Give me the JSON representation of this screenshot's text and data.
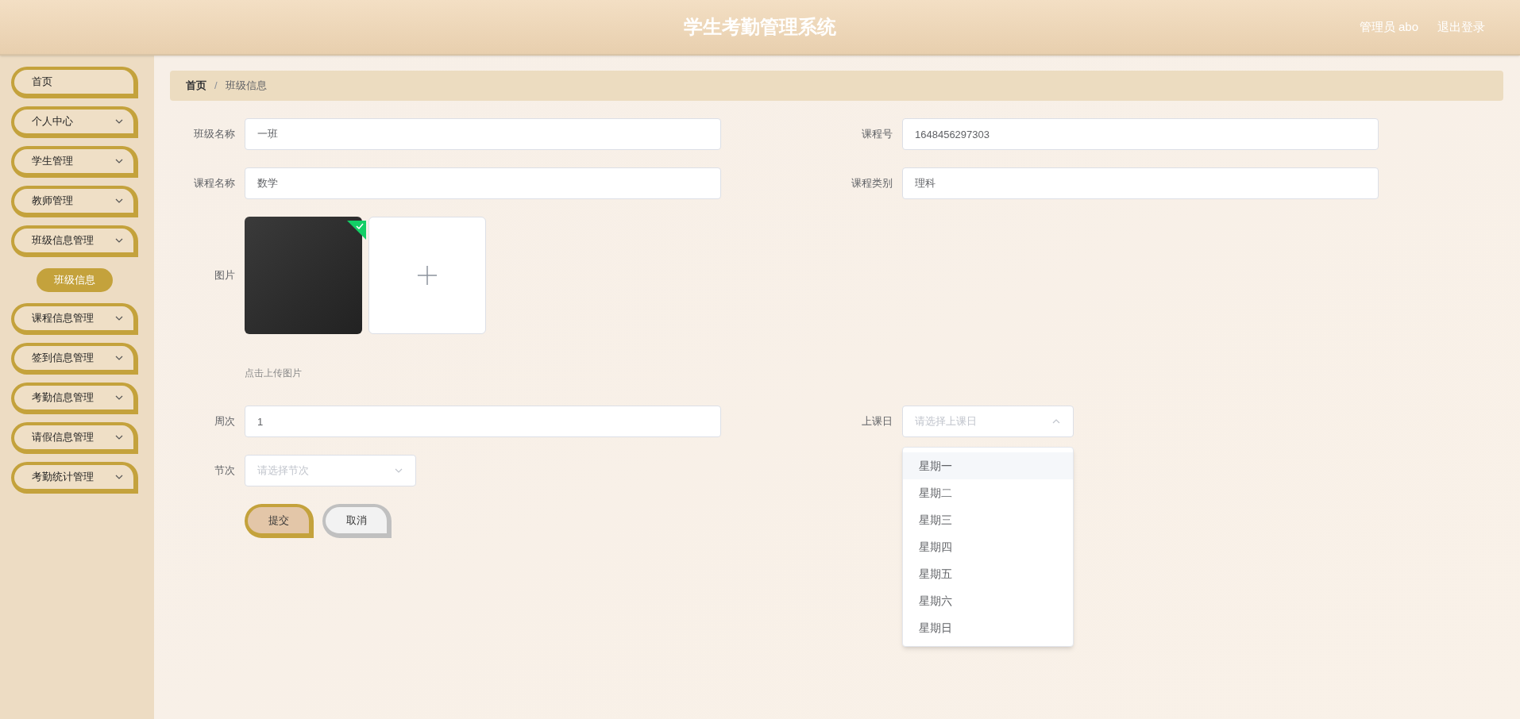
{
  "header": {
    "title": "学生考勤管理系统",
    "user": "管理员 abo",
    "logout": "退出登录"
  },
  "sidebar": {
    "items": [
      {
        "label": "首页",
        "has_arrow": false
      },
      {
        "label": "个人中心",
        "has_arrow": true
      },
      {
        "label": "学生管理",
        "has_arrow": true
      },
      {
        "label": "教师管理",
        "has_arrow": true
      },
      {
        "label": "班级信息管理",
        "has_arrow": true,
        "children": [
          {
            "label": "班级信息",
            "selected": true
          }
        ]
      },
      {
        "label": "课程信息管理",
        "has_arrow": true
      },
      {
        "label": "签到信息管理",
        "has_arrow": true
      },
      {
        "label": "考勤信息管理",
        "has_arrow": true
      },
      {
        "label": "请假信息管理",
        "has_arrow": true
      },
      {
        "label": "考勤统计管理",
        "has_arrow": true
      }
    ]
  },
  "breadcrumb": [
    "首页",
    "班级信息"
  ],
  "breadcrumb_separator": "/",
  "form": {
    "class_name": {
      "label": "班级名称",
      "value": "一班"
    },
    "course_no": {
      "label": "课程号",
      "value": "1648456297303"
    },
    "course_name": {
      "label": "课程名称",
      "value": "数学"
    },
    "course_type": {
      "label": "课程类别",
      "value": "理科"
    },
    "image": {
      "label": "图片",
      "uploaded": true,
      "hint": "点击上传图片"
    },
    "week": {
      "label": "周次",
      "value": "1"
    },
    "day": {
      "label": "上课日",
      "placeholder": "请选择上课日",
      "open": true,
      "options": [
        {
          "label": "星期一",
          "highlighted": true
        },
        {
          "label": "星期二",
          "highlighted": false
        },
        {
          "label": "星期三",
          "highlighted": false
        },
        {
          "label": "星期四",
          "highlighted": false
        },
        {
          "label": "星期五",
          "highlighted": false
        },
        {
          "label": "星期六",
          "highlighted": false
        },
        {
          "label": "星期日",
          "highlighted": false
        }
      ]
    },
    "period": {
      "label": "节次",
      "placeholder": "请选择节次",
      "open": false
    },
    "buttons": [
      {
        "label": "提交",
        "kind": "primary"
      },
      {
        "label": "取消",
        "kind": "secondary"
      }
    ]
  }
}
